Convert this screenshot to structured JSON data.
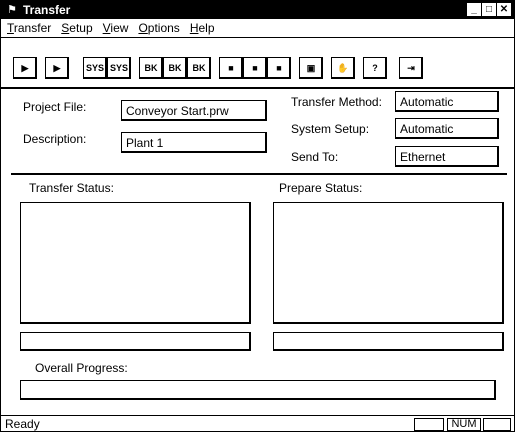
{
  "window": {
    "title": "Transfer",
    "minimize": "_",
    "maximize": "□",
    "close": "✕"
  },
  "menu": [
    {
      "label_u": "T",
      "label_rest": "ransfer"
    },
    {
      "label_u": "S",
      "label_rest": "etup"
    },
    {
      "label_u": "V",
      "label_rest": "iew"
    },
    {
      "label_u": "O",
      "label_rest": "ptions"
    },
    {
      "label_u": "H",
      "label_rest": "elp"
    }
  ],
  "toolbar": {
    "icons": [
      "transfer-to-display-icon",
      "transfer-from-display-icon",
      "sys-send-icon",
      "sys-receive-icon",
      "bk-send-icon",
      "bk-receive-icon",
      "bk-compare-icon",
      "project-send-icon",
      "project-receive-icon",
      "project-compare-icon",
      "memory-icon",
      "hand-stop-icon",
      "help-icon",
      "exit-icon"
    ],
    "labels": [
      "▶",
      "▶",
      "SYS",
      "SYS",
      "BK",
      "BK",
      "BK",
      "■",
      "■",
      "■",
      "▣",
      "✋",
      "?",
      "⇥"
    ]
  },
  "form": {
    "project_file_label": "Project File:",
    "project_file_value": "Conveyor Start.prw",
    "description_label": "Description:",
    "description_value": "Plant 1",
    "transfer_method_label": "Transfer Method:",
    "transfer_method_value": "Automatic",
    "system_setup_label": "System Setup:",
    "system_setup_value": "Automatic",
    "send_to_label": "Send To:",
    "send_to_value": "Ethernet"
  },
  "status": {
    "transfer_status_label": "Transfer Status:",
    "prepare_status_label": "Prepare Status:",
    "overall_progress_label": "Overall Progress:"
  },
  "statusbar": {
    "text": "Ready",
    "num": "NUM"
  }
}
